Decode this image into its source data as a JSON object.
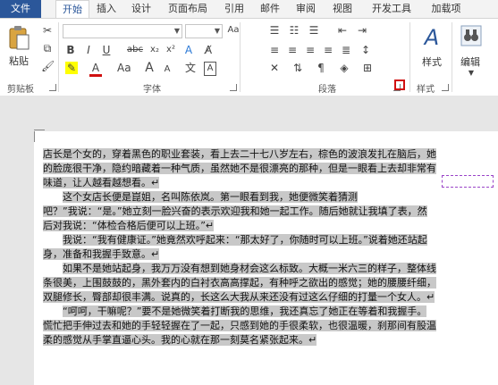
{
  "tabs": [
    "文件",
    "开始",
    "插入",
    "设计",
    "页面布局",
    "引用",
    "邮件",
    "审阅",
    "视图",
    "开发工具",
    "加载项"
  ],
  "ribbon": {
    "clipboard": {
      "paste_label": "粘贴",
      "group_label": "剪贴板"
    },
    "font": {
      "group_label": "字体",
      "font_name": "",
      "font_size": ""
    },
    "paragraph": {
      "group_label": "段落"
    },
    "styles": {
      "label": "样式",
      "group_label": "样式"
    },
    "editing": {
      "label": "编辑"
    }
  },
  "document": {
    "lines": [
      "店长是个女的，穿着黑色的职业套装，看上去二十七八岁左右，棕色的波浪发扎在脑后，她",
      "的脸庞很干净，隐约暗藏着一种气质，虽然她不是很漂亮的那种，但是一眼看上去却非常有",
      "味道，让人越看越想看。↵",
      "这个女店长便是崑姐，名叫陈依岚。第一眼看到我，她便微笑着猜测",
      "吧？”我说：“是。”她立刻一脸兴奋的表示欢迎我和她一起工作。随后她就让我填了表，然",
      "后对我说：“体检合格后便可以上班。”↵",
      "我说：“我有健康证。”她竟然欢呼起来：“那太好了，你随时可以上班。”说着她还站起",
      "身，准备和我握手致意。↵",
      "如果不是她站起身，我万万没有想到她身材会这么标致。大概一米六三的样子，整体线",
      "条很美，上围鼓鼓的，黑外套内的白衬衣高高撑起，有种呼之欲出的感觉；她的腰腰纤细，",
      "双腿修长，臀部却很丰满。说真的，长这么大我从来还没有过这么仔细的打量一个女人。↵",
      "“呵呵，干嘛呢？”要不是她微笑着打断我的思维，我还真忘了她正在等着和我握手。",
      "慌忙把手伸过去和她的手轻轻握在了一起，只感到她的手很柔软，也很温暖，刹那间有股温",
      "柔的感觉从手掌直逼心头。我的心就在那一刻莫名紧张起来。↵"
    ]
  }
}
